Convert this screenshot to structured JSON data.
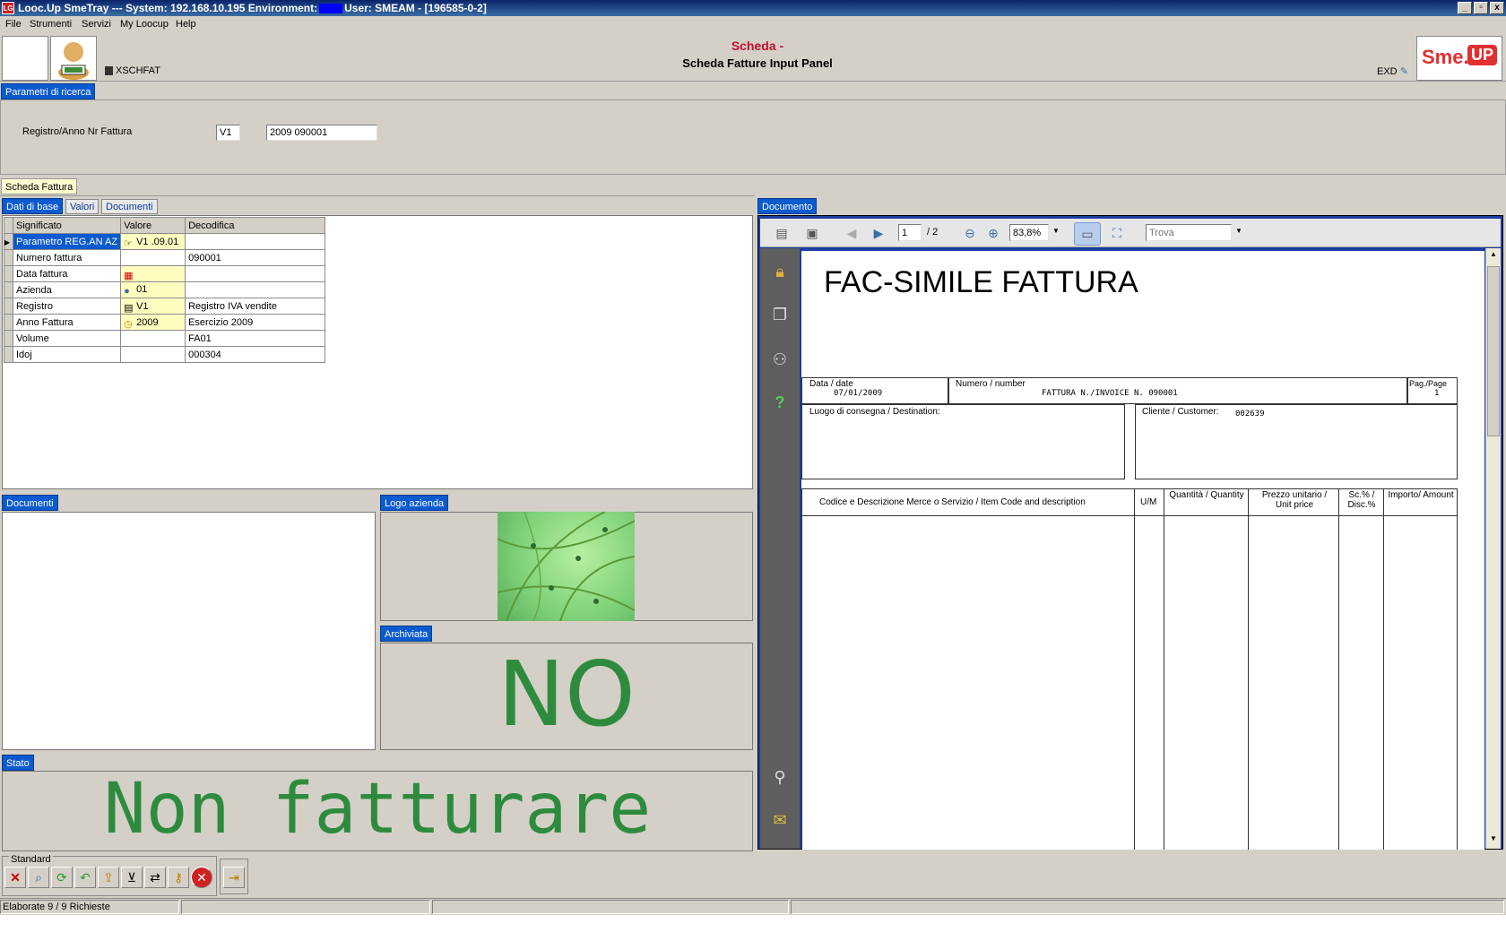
{
  "window": {
    "title_prefix": "Looc.Up SmeTray --- System: 192.168.10.195 Environment:",
    "title_suffix": "User: SMEAM - [196585-0-2]",
    "controls": [
      "_",
      "▫",
      "x"
    ]
  },
  "menu": [
    "File",
    "Strumenti",
    "Servizi",
    "My Loocup",
    "Help"
  ],
  "header": {
    "title_red": "Scheda -",
    "title": "Scheda Fatture Input Panel",
    "code": "XSCHFAT",
    "exd": "EXD",
    "logo_sme": "Sme.",
    "logo_up": "UP"
  },
  "search": {
    "tab": "Parametri di ricerca",
    "label": "Registro/Anno Nr Fattura",
    "registro": "V1",
    "anno_nr": "2009 090001"
  },
  "scheda_tab": "Scheda Fattura",
  "subtabs": [
    "Dati di base",
    "Valori",
    "Documenti"
  ],
  "grid": {
    "headers": [
      "Significato",
      "Valore",
      "Decodifica"
    ],
    "rows": [
      {
        "significato": "Parametro REG.AN AZ",
        "valore": "V1 .09.01",
        "decodifica": "",
        "icon": "hand-icon"
      },
      {
        "significato": "Numero fattura",
        "valore": "",
        "decodifica": "090001",
        "icon": ""
      },
      {
        "significato": "Data fattura",
        "valore": "",
        "decodifica": "",
        "icon": "calendar-icon"
      },
      {
        "significato": "Azienda",
        "valore": "01",
        "decodifica": "",
        "icon": "person-icon"
      },
      {
        "significato": "Registro",
        "valore": "V1",
        "decodifica": "Registro IVA vendite",
        "icon": "register-icon"
      },
      {
        "significato": "Anno Fattura",
        "valore": "2009",
        "decodifica": "Esercizio 2009",
        "icon": "clock-icon"
      },
      {
        "significato": "Volume",
        "valore": "",
        "decodifica": "FA01",
        "icon": ""
      },
      {
        "significato": "Idoj",
        "valore": "",
        "decodifica": "000304",
        "icon": ""
      }
    ]
  },
  "panels": {
    "documenti": "Documenti",
    "logo": "Logo azienda",
    "archiviata": "Archiviata",
    "archiviata_value": "NO",
    "stato": "Stato",
    "stato_value": "Non fatturare"
  },
  "viewer": {
    "tab": "Documento",
    "page_current": "1",
    "page_total": "/ 2",
    "zoom": "83,8%",
    "find_placeholder": "Trova",
    "doc": {
      "title": "FAC-SIMILE FATTURA",
      "date_label": "Data  / date",
      "date_value": "07/01/2009",
      "number_label": "Numero  / number",
      "number_value": "FATTURA N./INVOICE N.      090001",
      "page_label": "Pag./Page",
      "page_value": "1",
      "dest_label": "Luogo di consegna / Destination:",
      "customer_label": "Cliente / Customer:",
      "customer_value": "002639",
      "col_desc": "Codice e Descrizione Merce o Servizio / Item Code and description",
      "col_um": "U/M",
      "col_qty": "Quantità / Quantity",
      "col_price": "Prezzo unitario / Unit price",
      "col_disc": "Sc.% / Disc.%",
      "col_amount": "Importo/ Amount"
    }
  },
  "toolbar": {
    "group_label": "Standard"
  },
  "status": {
    "text": "Elaborate 9 / 9 Richieste"
  }
}
